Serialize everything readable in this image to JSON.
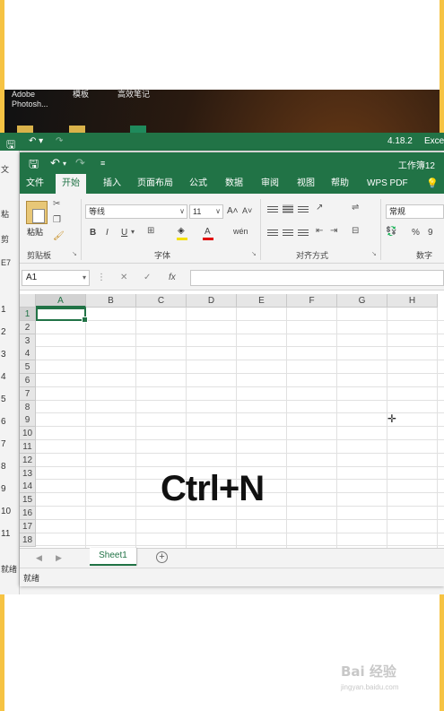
{
  "desktop": {
    "icons": [
      {
        "label": "Adobe\nPhotosh..."
      },
      {
        "label": "模板"
      },
      {
        "label": "高效笔记"
      }
    ]
  },
  "back_window": {
    "version": "4.18.2",
    "app": "Exce",
    "sidebar": [
      "文",
      "粘",
      "剪",
      "E7"
    ],
    "rows": [
      "1",
      "2",
      "3",
      "4",
      "5",
      "6",
      "7",
      "8",
      "9",
      "10",
      "11"
    ],
    "status": "就绪"
  },
  "window": {
    "doc_title": "工作簿12",
    "tabs": [
      "文件",
      "开始",
      "插入",
      "页面布局",
      "公式",
      "数据",
      "审阅",
      "视图",
      "帮助",
      "WPS PDF"
    ],
    "active_tab": "开始"
  },
  "ribbon": {
    "clipboard": {
      "paste": "粘贴",
      "label": "剪贴板"
    },
    "font": {
      "name": "等线",
      "size": "11",
      "label": "字体",
      "bold": "B",
      "italic": "I",
      "underline": "U",
      "grow": "A˄",
      "shrink": "A˅",
      "wen": "wén"
    },
    "alignment": {
      "label": "对齐方式"
    },
    "number": {
      "format": "常规",
      "label": "数字",
      "percent": "%",
      "comma": "9"
    }
  },
  "formula_bar": {
    "name_box": "A1",
    "cancel": "✕",
    "confirm": "✓",
    "fx": "fx",
    "value": ""
  },
  "grid": {
    "columns": [
      "A",
      "B",
      "C",
      "D",
      "E",
      "F",
      "G",
      "H"
    ],
    "rows": [
      "1",
      "2",
      "3",
      "4",
      "5",
      "6",
      "7",
      "8",
      "9",
      "10",
      "11",
      "12",
      "13",
      "14",
      "15",
      "16",
      "17",
      "18"
    ],
    "active_cell": "A1"
  },
  "overlay_text": "Ctrl+N",
  "sheets": {
    "tabs": [
      "Sheet1"
    ],
    "add": "+"
  },
  "status": {
    "text": "就绪"
  },
  "watermark": {
    "logo": "Bai 经验",
    "url": "jingyan.baidu.com"
  }
}
